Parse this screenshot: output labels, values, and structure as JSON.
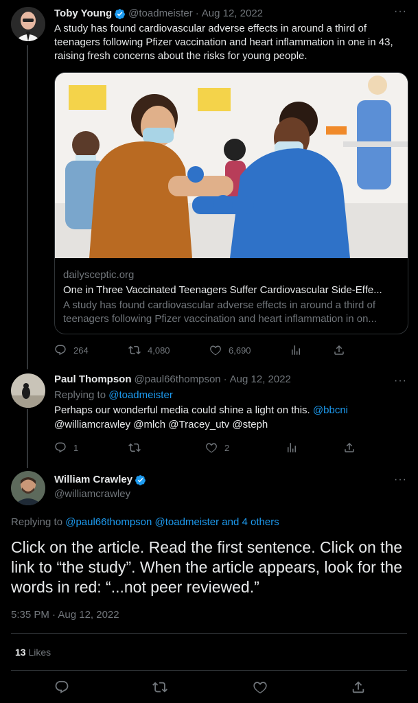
{
  "tweets": [
    {
      "name": "Toby Young",
      "handle": "@toadmeister",
      "date": "Aug 12, 2022",
      "text": "A study has found cardiovascular adverse effects in around a third of teenagers following Pfizer vaccination and heart inflammation in one in 43, raising fresh concerns about the risks for young people.",
      "card": {
        "domain": "dailysceptic.org",
        "title": "One in Three Vaccinated Teenagers Suffer Cardiovascular Side-Effe...",
        "desc_line1": "A study has found cardiovascular adverse effects in around a third of",
        "desc_line2": "teenagers following Pfizer vaccination and heart inflammation in on..."
      },
      "stats": {
        "replies": "264",
        "retweets": "4,080",
        "likes": "6,690"
      }
    },
    {
      "name": "Paul Thompson",
      "handle": "@paul66thompson",
      "date": "Aug 12, 2022",
      "replying_label": "Replying to",
      "replying_to": "@toadmeister",
      "text_plain": "Perhaps our wonderful media could shine a light on this.",
      "mention1": "@bbcni",
      "line2": "@williamcrawley @mlch @Tracey_utv @steph",
      "stats": {
        "replies": "1",
        "retweets": "",
        "likes": "2"
      }
    }
  ],
  "main_tweet": {
    "name": "William Crawley",
    "handle": "@williamcrawley",
    "replying_label": "Replying to",
    "replying_to": "@paul66thompson @toadmeister and 4 others",
    "text": "Click on the article. Read the first sentence. Click on the link to “the study”. When the article appears, look for the words in red: “...not peer reviewed.”",
    "timestamp": "5:35 PM · Aug 12, 2022",
    "likes_count": "13",
    "likes_label": "Likes"
  },
  "more_glyph": "···",
  "separator": "·",
  "colors": {
    "accent": "#1d9bf0",
    "muted": "#71767b",
    "bg": "#000000"
  }
}
